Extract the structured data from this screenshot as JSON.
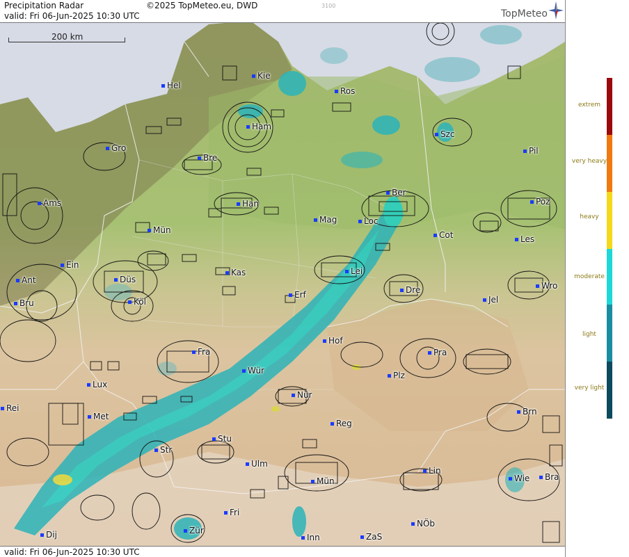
{
  "header": {
    "title": "Precipitation Radar",
    "copyright": "©2025 TopMeteo.eu, DWD",
    "code": "3100",
    "valid_top": "valid:  Fri  06-Jun-2025 10:30 UTC",
    "logo": "TopMeteo"
  },
  "footer": {
    "valid_bottom": "valid:  Fri  06-Jun-2025 10:30 UTC"
  },
  "scale": {
    "label": "200 km"
  },
  "cities": [
    {
      "id": "hel",
      "label": "Hel"
    },
    {
      "id": "kie",
      "label": "Kie"
    },
    {
      "id": "ros",
      "label": "Ros"
    },
    {
      "id": "ham",
      "label": "Ham"
    },
    {
      "id": "szc",
      "label": "Szc"
    },
    {
      "id": "gro",
      "label": "Gro"
    },
    {
      "id": "bre",
      "label": "Bre"
    },
    {
      "id": "pil",
      "label": "Pil"
    },
    {
      "id": "ams",
      "label": "Ams"
    },
    {
      "id": "han",
      "label": "Han"
    },
    {
      "id": "ber",
      "label": "Ber"
    },
    {
      "id": "poz",
      "label": "Poz"
    },
    {
      "id": "mag",
      "label": "Mag"
    },
    {
      "id": "loc",
      "label": "Loc"
    },
    {
      "id": "mun1",
      "label": "Mün"
    },
    {
      "id": "cot",
      "label": "Cot"
    },
    {
      "id": "les",
      "label": "Les"
    },
    {
      "id": "ein",
      "label": "Ein"
    },
    {
      "id": "kas",
      "label": "Kas"
    },
    {
      "id": "lei",
      "label": "Lei"
    },
    {
      "id": "ant",
      "label": "Ant"
    },
    {
      "id": "dus",
      "label": "Düs"
    },
    {
      "id": "dre",
      "label": "Dre"
    },
    {
      "id": "wro",
      "label": "Wro"
    },
    {
      "id": "bru",
      "label": "Bru"
    },
    {
      "id": "kol",
      "label": "Köl"
    },
    {
      "id": "erf",
      "label": "Erf"
    },
    {
      "id": "jel",
      "label": "Jel"
    },
    {
      "id": "hof",
      "label": "Hof"
    },
    {
      "id": "fra",
      "label": "Fra"
    },
    {
      "id": "pra",
      "label": "Pra"
    },
    {
      "id": "wur",
      "label": "Wür"
    },
    {
      "id": "plz",
      "label": "Plz"
    },
    {
      "id": "lux",
      "label": "Lux"
    },
    {
      "id": "nur",
      "label": "Nür"
    },
    {
      "id": "rei",
      "label": "Rei"
    },
    {
      "id": "met",
      "label": "Met"
    },
    {
      "id": "brn",
      "label": "Brn"
    },
    {
      "id": "reg",
      "label": "Reg"
    },
    {
      "id": "stu",
      "label": "Stu"
    },
    {
      "id": "str",
      "label": "Str"
    },
    {
      "id": "ulm",
      "label": "Ulm"
    },
    {
      "id": "lin",
      "label": "Lin"
    },
    {
      "id": "mun2",
      "label": "Mün"
    },
    {
      "id": "wie",
      "label": "Wie"
    },
    {
      "id": "bra",
      "label": "Bra"
    },
    {
      "id": "fri",
      "label": "Fri"
    },
    {
      "id": "dij",
      "label": "Dij"
    },
    {
      "id": "zur",
      "label": "Zür"
    },
    {
      "id": "nob",
      "label": "NÖb"
    },
    {
      "id": "inn",
      "label": "Inn"
    },
    {
      "id": "zas",
      "label": "ZaS"
    }
  ],
  "legend": [
    {
      "label": "extrem",
      "color": "#9b0a0a"
    },
    {
      "label": "very heavy",
      "color": "#ef7a12"
    },
    {
      "label": "heavy",
      "color": "#f4d81c"
    },
    {
      "label": "moderate",
      "color": "#1ed8d8"
    },
    {
      "label": "light",
      "color": "#1a8ea0"
    },
    {
      "label": "very light",
      "color": "#0c4a5c"
    }
  ]
}
